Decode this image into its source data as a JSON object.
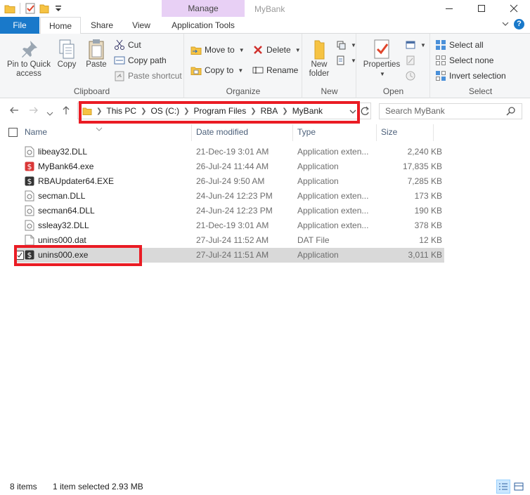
{
  "window": {
    "title": "MyBank",
    "contextual_tab": "Manage"
  },
  "tabs": {
    "file": "File",
    "home": "Home",
    "share": "Share",
    "view": "View",
    "application_tools": "Application Tools"
  },
  "ribbon": {
    "clipboard": {
      "label": "Clipboard",
      "pin_line1": "Pin to Quick",
      "pin_line2": "access",
      "copy": "Copy",
      "paste": "Paste",
      "cut": "Cut",
      "copy_path": "Copy path",
      "paste_shortcut": "Paste shortcut"
    },
    "organize": {
      "label": "Organize",
      "move_to": "Move to",
      "copy_to": "Copy to",
      "delete": "Delete",
      "rename": "Rename"
    },
    "new": {
      "label": "New",
      "new_folder_line1": "New",
      "new_folder_line2": "folder"
    },
    "open": {
      "label": "Open",
      "properties": "Properties"
    },
    "select": {
      "label": "Select",
      "select_all": "Select all",
      "select_none": "Select none",
      "invert_selection": "Invert selection"
    }
  },
  "address": {
    "crumbs": [
      "This PC",
      "OS (C:)",
      "Program Files",
      "RBA",
      "MyBank"
    ],
    "search_placeholder": "Search MyBank"
  },
  "columns": {
    "name": "Name",
    "date_modified": "Date modified",
    "type": "Type",
    "size": "Size"
  },
  "files": [
    {
      "name": "libeay32.DLL",
      "date": "21-Dec-19 3:01 AM",
      "type": "Application exten...",
      "size": "2,240 KB",
      "icon": "dll-icon"
    },
    {
      "name": "MyBank64.exe",
      "date": "26-Jul-24 11:44 AM",
      "type": "Application",
      "size": "17,835 KB",
      "icon": "mybank-app-icon"
    },
    {
      "name": "RBAUpdater64.EXE",
      "date": "26-Jul-24 9:50 AM",
      "type": "Application",
      "size": "7,285 KB",
      "icon": "updater-app-icon"
    },
    {
      "name": "secman.DLL",
      "date": "24-Jun-24 12:23 PM",
      "type": "Application exten...",
      "size": "173 KB",
      "icon": "dll-icon"
    },
    {
      "name": "secman64.DLL",
      "date": "24-Jun-24 12:23 PM",
      "type": "Application exten...",
      "size": "190 KB",
      "icon": "dll-icon"
    },
    {
      "name": "ssleay32.DLL",
      "date": "21-Dec-19 3:01 AM",
      "type": "Application exten...",
      "size": "378 KB",
      "icon": "dll-icon"
    },
    {
      "name": "unins000.dat",
      "date": "27-Jul-24 11:52 AM",
      "type": "DAT File",
      "size": "12 KB",
      "icon": "dat-file-icon"
    },
    {
      "name": "unins000.exe",
      "date": "27-Jul-24 11:51 AM",
      "type": "Application",
      "size": "3,011 KB",
      "icon": "uninstaller-app-icon",
      "selected": true
    }
  ],
  "status": {
    "item_count": "8 items",
    "selection": "1 item selected  2.93 MB"
  },
  "colors": {
    "file_tab": "#1979ca",
    "manage_tab": "#e8d0f5",
    "highlight_box": "#ea1c24",
    "selected_row": "#d9d9d9"
  }
}
